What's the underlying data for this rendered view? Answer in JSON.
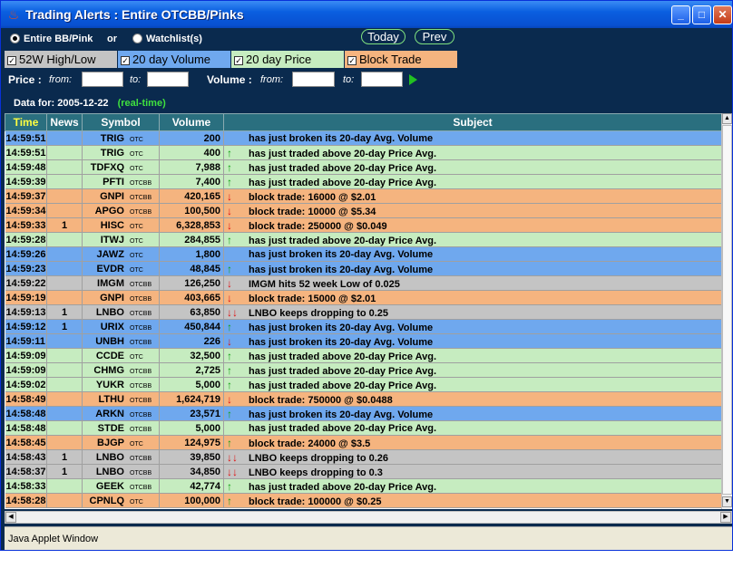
{
  "window": {
    "title": "Trading Alerts : Entire OTCBB/Pinks",
    "app_icon": "java-cup-icon",
    "buttons": {
      "minimize": "_",
      "maximize": "□",
      "close": "✕"
    }
  },
  "filters": {
    "scope": [
      {
        "label": "Entire BB/Pink",
        "selected": true
      },
      {
        "label": "Watchlist(s)",
        "selected": false
      }
    ],
    "or_label": "or",
    "today_label": "Today",
    "prev_label": "Prev",
    "types": [
      {
        "label": "52W High/Low",
        "checked": true,
        "color": "#c4c4c4"
      },
      {
        "label": "20 day Volume",
        "checked": true,
        "color": "#6fa8ee"
      },
      {
        "label": "20 day Price",
        "checked": true,
        "color": "#c6ecc0"
      },
      {
        "label": "Block Trade",
        "checked": true,
        "color": "#f5b47f"
      }
    ],
    "price_label": "Price :",
    "volume_label": "Volume :",
    "from_label": "from:",
    "to_label": "to:",
    "price_from": "",
    "price_to": "",
    "volume_from": "",
    "volume_to": ""
  },
  "data_for": {
    "label": "Data for: 2005-12-22",
    "status": "(real-time)"
  },
  "table": {
    "headers": {
      "time": "Time",
      "news": "News",
      "symbol": "Symbol",
      "volume": "Volume",
      "subject": "Subject"
    },
    "rows": [
      {
        "time": "14:59:51",
        "news": "",
        "symbol": "TRIG",
        "exch": "OTC",
        "volume": "200",
        "arrow": "",
        "subject": "has just broken its 20-day Avg. Volume",
        "kind": "blue"
      },
      {
        "time": "14:59:51",
        "news": "",
        "symbol": "TRIG",
        "exch": "OTC",
        "volume": "400",
        "arrow": "↑",
        "subject": "has just traded above 20-day Price Avg.",
        "kind": "green"
      },
      {
        "time": "14:59:48",
        "news": "",
        "symbol": "TDFXQ",
        "exch": "OTC",
        "volume": "7,988",
        "arrow": "↑",
        "subject": "has just traded above 20-day Price Avg.",
        "kind": "green"
      },
      {
        "time": "14:59:39",
        "news": "",
        "symbol": "PFTI",
        "exch": "OTCBB",
        "volume": "7,400",
        "arrow": "↑",
        "subject": "has just traded above 20-day Price Avg.",
        "kind": "green"
      },
      {
        "time": "14:59:37",
        "news": "",
        "symbol": "GNPI",
        "exch": "OTCBB",
        "volume": "420,165",
        "arrow": "↓",
        "subject": "block trade: 16000 @ $2.01",
        "kind": "orange"
      },
      {
        "time": "14:59:34",
        "news": "",
        "symbol": "APGO",
        "exch": "OTCBB",
        "volume": "100,500",
        "arrow": "↓",
        "subject": "block trade: 10000 @ $5.34",
        "kind": "orange"
      },
      {
        "time": "14:59:33",
        "news": "1",
        "symbol": "HISC",
        "exch": "OTC",
        "volume": "6,328,853",
        "arrow": "↓",
        "subject": "block trade: 250000 @ $0.049",
        "kind": "orange"
      },
      {
        "time": "14:59:28",
        "news": "",
        "symbol": "ITWJ",
        "exch": "OTC",
        "volume": "284,855",
        "arrow": "↑",
        "subject": "has just traded above 20-day Price Avg.",
        "kind": "green"
      },
      {
        "time": "14:59:26",
        "news": "",
        "symbol": "JAWZ",
        "exch": "OTC",
        "volume": "1,800",
        "arrow": "",
        "subject": "has just broken its 20-day Avg. Volume",
        "kind": "blue"
      },
      {
        "time": "14:59:23",
        "news": "",
        "symbol": "EVDR",
        "exch": "OTC",
        "volume": "48,845",
        "arrow": "↑",
        "subject": "has just broken its 20-day Avg. Volume",
        "kind": "blue"
      },
      {
        "time": "14:59:22",
        "news": "",
        "symbol": "IMGM",
        "exch": "OTCBB",
        "volume": "126,250",
        "arrow": "↓",
        "subject": "IMGM hits 52 week Low of 0.025",
        "kind": "gray"
      },
      {
        "time": "14:59:19",
        "news": "",
        "symbol": "GNPI",
        "exch": "OTCBB",
        "volume": "403,665",
        "arrow": "↓",
        "subject": "block trade: 15000 @ $2.01",
        "kind": "orange"
      },
      {
        "time": "14:59:13",
        "news": "1",
        "symbol": "LNBO",
        "exch": "OTCBB",
        "volume": "63,850",
        "arrow": "↓↓",
        "subject": "LNBO keeps dropping to 0.25",
        "kind": "gray"
      },
      {
        "time": "14:59:12",
        "news": "1",
        "symbol": "URIX",
        "exch": "OTCBB",
        "volume": "450,844",
        "arrow": "↑",
        "subject": "has just broken its 20-day Avg. Volume",
        "kind": "blue"
      },
      {
        "time": "14:59:11",
        "news": "",
        "symbol": "UNBH",
        "exch": "OTCBB",
        "volume": "226",
        "arrow": "↓",
        "subject": "has just broken its 20-day Avg. Volume",
        "kind": "blue"
      },
      {
        "time": "14:59:09",
        "news": "",
        "symbol": "CCDE",
        "exch": "OTC",
        "volume": "32,500",
        "arrow": "↑",
        "subject": "has just traded above 20-day Price Avg.",
        "kind": "green"
      },
      {
        "time": "14:59:09",
        "news": "",
        "symbol": "CHMG",
        "exch": "OTCBB",
        "volume": "2,725",
        "arrow": "↑",
        "subject": "has just traded above 20-day Price Avg.",
        "kind": "green"
      },
      {
        "time": "14:59:02",
        "news": "",
        "symbol": "YUKR",
        "exch": "OTCBB",
        "volume": "5,000",
        "arrow": "↑",
        "subject": "has just traded above 20-day Price Avg.",
        "kind": "green"
      },
      {
        "time": "14:58:49",
        "news": "",
        "symbol": "LTHU",
        "exch": "OTCBB",
        "volume": "1,624,719",
        "arrow": "↓",
        "subject": "block trade: 750000 @ $0.0488",
        "kind": "orange"
      },
      {
        "time": "14:58:48",
        "news": "",
        "symbol": "ARKN",
        "exch": "OTCBB",
        "volume": "23,571",
        "arrow": "↑",
        "subject": "has just broken its 20-day Avg. Volume",
        "kind": "blue"
      },
      {
        "time": "14:58:48",
        "news": "",
        "symbol": "STDE",
        "exch": "OTCBB",
        "volume": "5,000",
        "arrow": "",
        "subject": "has just traded above 20-day Price Avg.",
        "kind": "green"
      },
      {
        "time": "14:58:45",
        "news": "",
        "symbol": "BJGP",
        "exch": "OTC",
        "volume": "124,975",
        "arrow": "↑",
        "subject": "block trade: 24000 @ $3.5",
        "kind": "orange"
      },
      {
        "time": "14:58:43",
        "news": "1",
        "symbol": "LNBO",
        "exch": "OTCBB",
        "volume": "39,850",
        "arrow": "↓↓",
        "subject": "LNBO keeps dropping to 0.26",
        "kind": "gray"
      },
      {
        "time": "14:58:37",
        "news": "1",
        "symbol": "LNBO",
        "exch": "OTCBB",
        "volume": "34,850",
        "arrow": "↓↓",
        "subject": "LNBO keeps dropping to 0.3",
        "kind": "gray"
      },
      {
        "time": "14:58:33",
        "news": "",
        "symbol": "GEEK",
        "exch": "OTCBB",
        "volume": "42,774",
        "arrow": "↑",
        "subject": "has just traded above 20-day Price Avg.",
        "kind": "green"
      },
      {
        "time": "14:58:28",
        "news": "",
        "symbol": "CPNLQ",
        "exch": "OTC",
        "volume": "100,000",
        "arrow": "↑",
        "subject": "block trade: 100000 @ $0.25",
        "kind": "orange"
      }
    ]
  },
  "status_bar": {
    "text": "Java Applet Window"
  }
}
